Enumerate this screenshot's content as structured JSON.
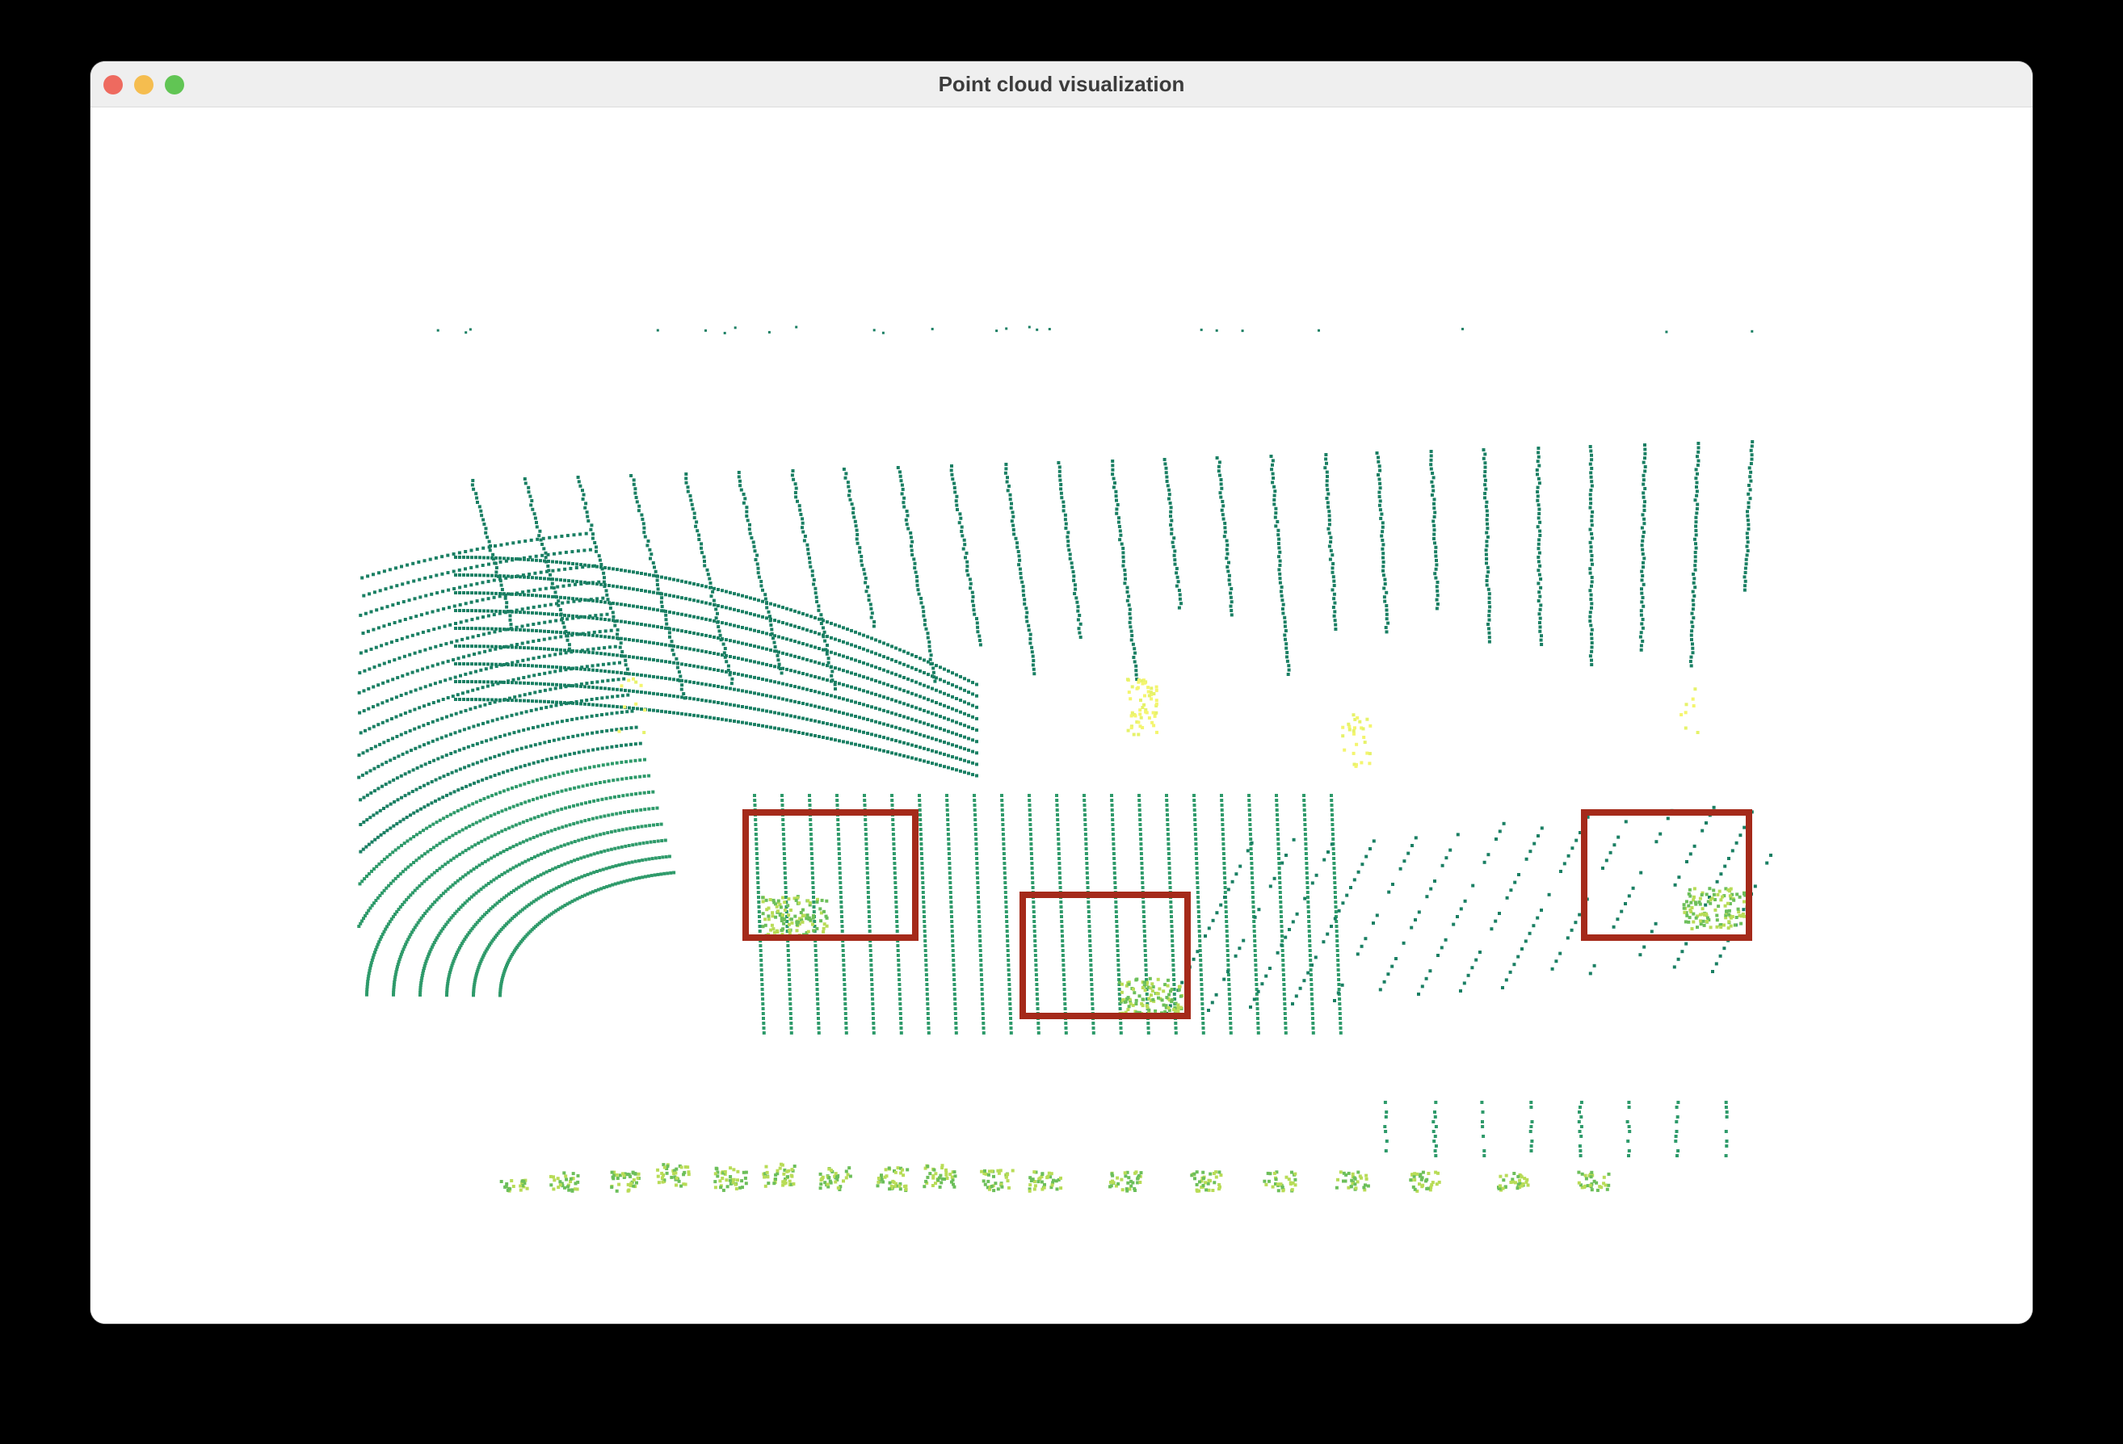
{
  "window": {
    "title": "Point cloud visualization",
    "controls": {
      "close": {
        "icon": "close-dot-icon",
        "color": "#ee6a5f"
      },
      "minimize": {
        "icon": "minimize-dot-icon",
        "color": "#f5bd4f"
      },
      "zoom": {
        "icon": "zoom-dot-icon",
        "color": "#61c554"
      }
    }
  },
  "viewer": {
    "background": "#ffffff",
    "colormap": [
      "#1a7f63",
      "#2e9a6a",
      "#6cbf5a",
      "#b8dc57",
      "#e6f26a",
      "#f4f56f"
    ],
    "box_color": "#a52a1a",
    "detection_count": 3
  }
}
